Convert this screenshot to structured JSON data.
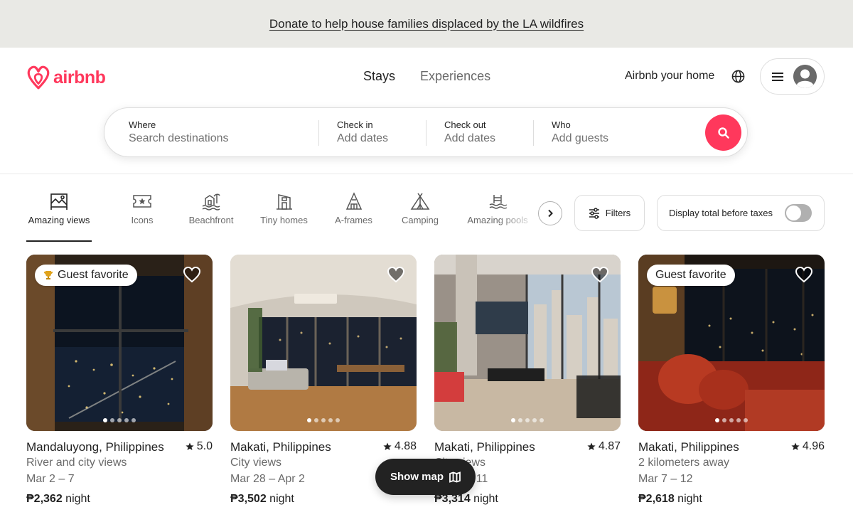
{
  "banner": {
    "text": "Donate to help house families displaced by the LA wildfires"
  },
  "header": {
    "logo_text": "airbnb",
    "tabs": [
      {
        "label": "Stays",
        "active": true
      },
      {
        "label": "Experiences",
        "active": false
      }
    ],
    "host_link": "Airbnb your home"
  },
  "search": {
    "where_label": "Where",
    "where_placeholder": "Search destinations",
    "checkin_label": "Check in",
    "checkin_value": "Add dates",
    "checkout_label": "Check out",
    "checkout_value": "Add dates",
    "who_label": "Who",
    "who_value": "Add guests"
  },
  "categories": [
    {
      "label": "Amazing views",
      "icon": "amazing-views-icon",
      "active": true
    },
    {
      "label": "Icons",
      "icon": "icons-icon"
    },
    {
      "label": "Beachfront",
      "icon": "beachfront-icon"
    },
    {
      "label": "Tiny homes",
      "icon": "tiny-homes-icon"
    },
    {
      "label": "A-frames",
      "icon": "a-frames-icon"
    },
    {
      "label": "Camping",
      "icon": "camping-icon"
    },
    {
      "label": "Amazing pools",
      "icon": "amazing-pools-icon"
    }
  ],
  "filters": {
    "label": "Filters",
    "tax_label": "Display total before taxes",
    "tax_on": false
  },
  "listings": [
    {
      "badge": "Guest favorite",
      "trophy": true,
      "title": "Mandaluyong, Philippines",
      "rating": "5.0",
      "subtitle": "River and city views",
      "dates": "Mar 2 – 7",
      "price": "₱2,362",
      "price_unit": "night"
    },
    {
      "badge": "",
      "title": "Makati, Philippines",
      "rating": "4.88",
      "subtitle": "City views",
      "dates": "Mar 28 – Apr 2",
      "price": "₱3,502",
      "price_unit": "night"
    },
    {
      "badge": "",
      "title": "Makati, Philippines",
      "rating": "4.87",
      "subtitle": "City views",
      "dates": "Mar 6 – 11",
      "price": "₱3,314",
      "price_unit": "night"
    },
    {
      "badge": "Guest favorite",
      "trophy": false,
      "title": "Makati, Philippines",
      "rating": "4.96",
      "subtitle": "2 kilometers away",
      "dates": "Mar 7 – 12",
      "price": "₱2,618",
      "price_unit": "night"
    }
  ],
  "show_map": {
    "label": "Show map"
  },
  "colors": {
    "brand": "#ff385c",
    "text": "#222222",
    "muted": "#6a6a6a",
    "banner_bg": "#e9e9e5"
  }
}
